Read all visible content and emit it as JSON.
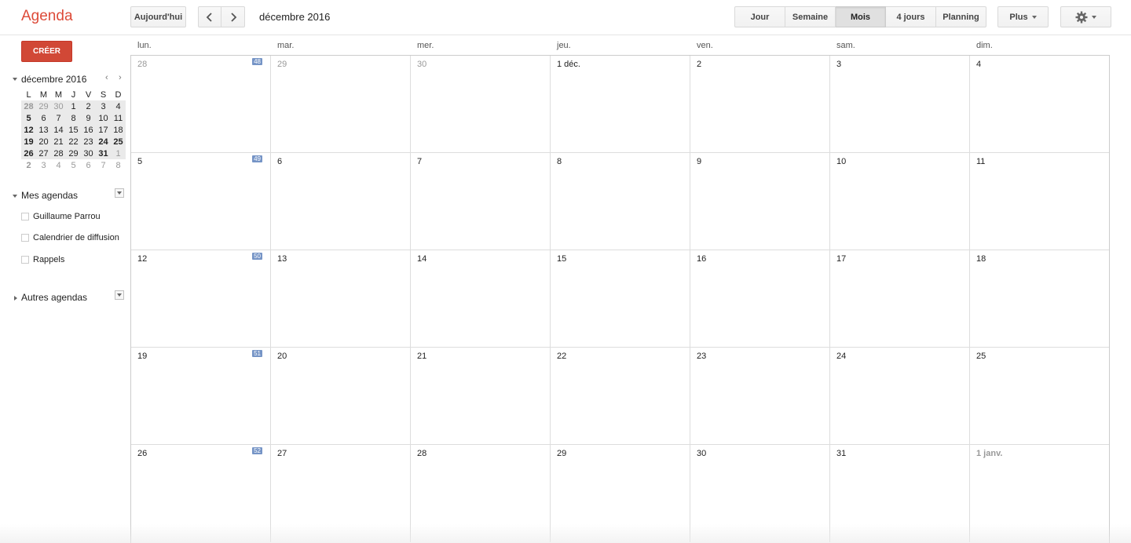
{
  "header": {
    "app_title": "Agenda",
    "today_label": "Aujourd'hui",
    "date_range": "décembre 2016",
    "views": [
      {
        "label": "Jour",
        "active": false
      },
      {
        "label": "Semaine",
        "active": false
      },
      {
        "label": "Mois",
        "active": true
      },
      {
        "label": "4 jours",
        "active": false
      },
      {
        "label": "Planning",
        "active": false
      }
    ],
    "more_label": "Plus"
  },
  "sidebar": {
    "create_label": "CRÉER",
    "mini_calendar": {
      "title": "décembre 2016",
      "prev_label": "‹",
      "next_label": "›",
      "weekdays": [
        "L",
        "M",
        "M",
        "J",
        "V",
        "S",
        "D"
      ],
      "weeks": [
        [
          "28",
          "29",
          "30",
          "1",
          "2",
          "3",
          "4"
        ],
        [
          "5",
          "6",
          "7",
          "8",
          "9",
          "10",
          "11"
        ],
        [
          "12",
          "13",
          "14",
          "15",
          "16",
          "17",
          "18"
        ],
        [
          "19",
          "20",
          "21",
          "22",
          "23",
          "24",
          "25"
        ],
        [
          "26",
          "27",
          "28",
          "29",
          "30",
          "31",
          "1"
        ],
        [
          "2",
          "3",
          "4",
          "5",
          "6",
          "7",
          "8"
        ]
      ]
    },
    "my_calendars": {
      "title": "Mes agendas",
      "items": [
        "Guillaume Parrou",
        "Calendrier de diffusion",
        "Rappels"
      ]
    },
    "other_calendars": {
      "title": "Autres agendas"
    }
  },
  "month": {
    "weekdays": [
      "lun.",
      "mar.",
      "mer.",
      "jeu.",
      "ven.",
      "sam.",
      "dim."
    ],
    "weeks": [
      {
        "week_number": "48",
        "days": [
          "28",
          "29",
          "30",
          "1 déc.",
          "2",
          "3",
          "4"
        ]
      },
      {
        "week_number": "49",
        "days": [
          "5",
          "6",
          "7",
          "8",
          "9",
          "10",
          "11"
        ]
      },
      {
        "week_number": "50",
        "days": [
          "12",
          "13",
          "14",
          "15",
          "16",
          "17",
          "18"
        ]
      },
      {
        "week_number": "51",
        "days": [
          "19",
          "20",
          "21",
          "22",
          "23",
          "24",
          "25"
        ]
      },
      {
        "week_number": "52",
        "days": [
          "26",
          "27",
          "28",
          "29",
          "30",
          "31",
          "1 janv."
        ]
      }
    ]
  },
  "icons": {
    "prev": "chevron-left-icon",
    "next": "chevron-right-icon",
    "settings": "gear-icon"
  }
}
